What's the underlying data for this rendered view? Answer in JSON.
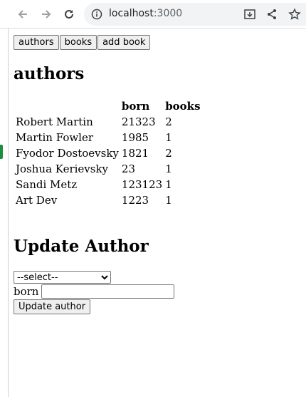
{
  "browser": {
    "url_host": "localhost",
    "url_port": ":3000"
  },
  "nav": {
    "authors_label": "authors",
    "books_label": "books",
    "add_book_label": "add book"
  },
  "authors_section": {
    "heading": "authors",
    "columns": [
      "",
      "born",
      "books"
    ],
    "rows": [
      [
        "Robert Martin",
        "21323",
        "2"
      ],
      [
        "Martin Fowler",
        "1985",
        "1"
      ],
      [
        "Fyodor Dostoevsky",
        "1821",
        "2"
      ],
      [
        "Joshua Kerievsky",
        "23",
        "1"
      ],
      [
        "Sandi Metz",
        "123123",
        "1"
      ],
      [
        "Art Dev",
        "1223",
        "1"
      ]
    ]
  },
  "update_section": {
    "heading": "Update Author",
    "select_value": "--select--",
    "born_label": "born",
    "born_value": "",
    "submit_label": "Update author"
  },
  "colors": {
    "accent_tab": "#1e8e3e"
  }
}
